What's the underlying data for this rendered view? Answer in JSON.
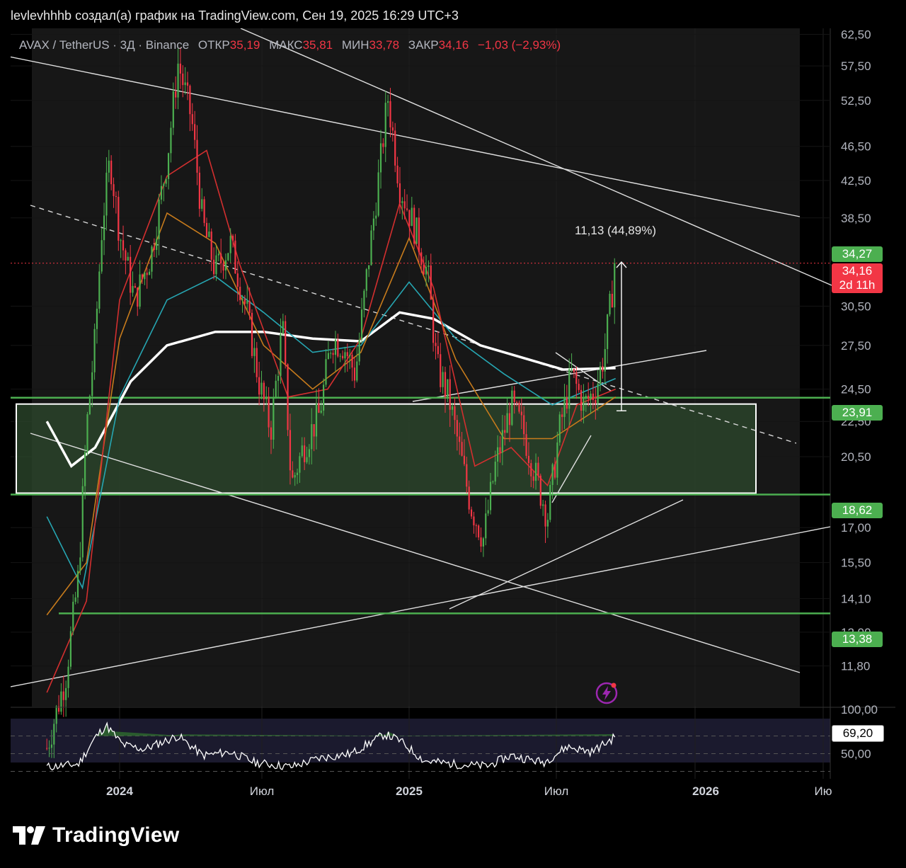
{
  "header": {
    "text": "levlevhhhb создал(а) график на TradingView.com, Сен 19, 2025 16:29 UTC+3"
  },
  "legend": {
    "symbol": "AVAX / TetherUS · 3Д · Binance",
    "open_label": "ОТКР",
    "open": "35,19",
    "high_label": "МАКС",
    "high": "35,81",
    "low_label": "МИН",
    "low": "33,78",
    "close_label": "ЗАКР",
    "close": "34,16",
    "change": "−1,03 (−2,93%)"
  },
  "measure_label": "11,13 (44,89%)",
  "price_tags": {
    "top": "34,27",
    "current": "34,16",
    "countdown": "2d 11h",
    "level_a": "23,91",
    "level_b": "18,62",
    "level_c": "13,38",
    "rsi_value": "69,20"
  },
  "colors": {
    "bull": "#4caf50",
    "bear": "#f23645",
    "level_green": "#4caf50",
    "zone_fill": "#2e4a2e",
    "ema_white": "#ffffff",
    "ema_red": "#d32f2f",
    "ema_orange": "#c77b1c",
    "ema_teal": "#26a6b2",
    "rsi_band": "#1b1a2e",
    "brand_purple": "#9c27b0"
  },
  "icons": {
    "brand": "tradingview-logo-icon",
    "alert": "lightning-bolt-icon"
  },
  "chart_data": {
    "type": "candlestick",
    "title": "AVAX / TetherUS · 3Д · Binance",
    "y_axis": {
      "scale": "log",
      "ticks": [
        "62,50",
        "57,50",
        "52,50",
        "46,50",
        "42,50",
        "38,50",
        "30,50",
        "27,50",
        "24,50",
        "22,50",
        "20,50",
        "17,00",
        "15,50",
        "14,10",
        "12,90",
        "11,80"
      ]
    },
    "x_axis": {
      "ticks": [
        "2024",
        "Июл",
        "2025",
        "Июл",
        "2026",
        "Ию"
      ]
    },
    "price_path": [
      [
        "2023-10-01",
        9.5
      ],
      [
        "2023-10-25",
        11.5
      ],
      [
        "2023-11-10",
        15.0
      ],
      [
        "2023-11-20",
        22.0
      ],
      [
        "2023-12-01",
        28.0
      ],
      [
        "2023-12-10",
        38.0
      ],
      [
        "2023-12-20",
        45.0
      ],
      [
        "2024-01-01",
        37.0
      ],
      [
        "2024-01-20",
        31.0
      ],
      [
        "2024-02-10",
        35.0
      ],
      [
        "2024-03-01",
        45.0
      ],
      [
        "2024-03-15",
        58.0
      ],
      [
        "2024-04-01",
        50.0
      ],
      [
        "2024-04-15",
        38.0
      ],
      [
        "2024-05-01",
        33.5
      ],
      [
        "2024-05-20",
        36.0
      ],
      [
        "2024-06-10",
        30.0
      ],
      [
        "2024-06-25",
        25.0
      ],
      [
        "2024-07-10",
        22.0
      ],
      [
        "2024-07-25",
        29.0
      ],
      [
        "2024-08-05",
        19.0
      ],
      [
        "2024-08-20",
        21.0
      ],
      [
        "2024-09-10",
        23.0
      ],
      [
        "2024-09-25",
        28.0
      ],
      [
        "2024-10-10",
        27.5
      ],
      [
        "2024-10-25",
        25.5
      ],
      [
        "2024-11-10",
        34.0
      ],
      [
        "2024-11-25",
        44.0
      ],
      [
        "2024-12-05",
        53.0
      ],
      [
        "2024-12-20",
        42.0
      ],
      [
        "2025-01-10",
        37.0
      ],
      [
        "2025-01-25",
        33.0
      ],
      [
        "2025-02-05",
        26.0
      ],
      [
        "2025-02-20",
        24.0
      ],
      [
        "2025-03-05",
        21.0
      ],
      [
        "2025-03-20",
        18.0
      ],
      [
        "2025-04-05",
        16.5
      ],
      [
        "2025-04-20",
        20.0
      ],
      [
        "2025-05-10",
        23.5
      ],
      [
        "2025-05-25",
        22.0
      ],
      [
        "2025-06-10",
        19.5
      ],
      [
        "2025-06-25",
        17.5
      ],
      [
        "2025-07-10",
        22.0
      ],
      [
        "2025-07-25",
        25.5
      ],
      [
        "2025-08-10",
        23.5
      ],
      [
        "2025-08-25",
        24.5
      ],
      [
        "2025-09-05",
        27.0
      ],
      [
        "2025-09-19",
        34.16
      ]
    ],
    "moving_averages": [
      {
        "color": "white",
        "points": [
          [
            "2023-10-01",
            22.5
          ],
          [
            "2023-11-01",
            20.0
          ],
          [
            "2023-12-01",
            21.0
          ],
          [
            "2024-01-15",
            25.0
          ],
          [
            "2024-03-01",
            27.5
          ],
          [
            "2024-05-01",
            28.5
          ],
          [
            "2024-07-01",
            28.5
          ],
          [
            "2024-09-01",
            28.0
          ],
          [
            "2024-11-01",
            27.8
          ],
          [
            "2024-12-20",
            30.0
          ],
          [
            "2025-02-01",
            29.5
          ],
          [
            "2025-04-01",
            27.5
          ],
          [
            "2025-06-01",
            26.5
          ],
          [
            "2025-07-15",
            25.8
          ],
          [
            "2025-09-19",
            25.9
          ]
        ]
      },
      {
        "color": "teal",
        "points": [
          [
            "2023-10-01",
            17.5
          ],
          [
            "2023-11-15",
            14.5
          ],
          [
            "2024-01-01",
            24.0
          ],
          [
            "2024-03-01",
            31.0
          ],
          [
            "2024-05-01",
            33.0
          ],
          [
            "2024-07-01",
            30.0
          ],
          [
            "2024-09-01",
            27.0
          ],
          [
            "2024-11-01",
            27.5
          ],
          [
            "2025-01-01",
            32.5
          ],
          [
            "2025-03-01",
            28.0
          ],
          [
            "2025-05-01",
            25.5
          ],
          [
            "2025-07-01",
            23.5
          ],
          [
            "2025-09-19",
            25.2
          ]
        ]
      },
      {
        "color": "orange",
        "points": [
          [
            "2023-10-01",
            13.5
          ],
          [
            "2023-11-20",
            15.5
          ],
          [
            "2024-01-01",
            28.0
          ],
          [
            "2024-03-01",
            39.0
          ],
          [
            "2024-05-01",
            36.0
          ],
          [
            "2024-07-01",
            27.5
          ],
          [
            "2024-09-01",
            24.5
          ],
          [
            "2024-11-01",
            27.0
          ],
          [
            "2025-01-01",
            36.5
          ],
          [
            "2025-03-01",
            26.5
          ],
          [
            "2025-05-01",
            21.5
          ],
          [
            "2025-07-01",
            21.5
          ],
          [
            "2025-09-19",
            24.0
          ]
        ]
      },
      {
        "color": "red",
        "points": [
          [
            "2023-10-01",
            11.0
          ],
          [
            "2023-11-20",
            14.0
          ],
          [
            "2024-01-01",
            31.0
          ],
          [
            "2024-03-01",
            43.0
          ],
          [
            "2024-04-20",
            46.0
          ],
          [
            "2024-06-01",
            34.0
          ],
          [
            "2024-08-01",
            24.0
          ],
          [
            "2024-09-20",
            24.5
          ],
          [
            "2024-11-01",
            28.0
          ],
          [
            "2024-12-20",
            40.0
          ],
          [
            "2025-02-01",
            32.0
          ],
          [
            "2025-03-25",
            20.0
          ],
          [
            "2025-05-10",
            21.0
          ],
          [
            "2025-06-25",
            19.0
          ],
          [
            "2025-08-01",
            23.5
          ],
          [
            "2025-09-19",
            24.5
          ]
        ]
      }
    ],
    "levels": [
      23.91,
      18.62,
      13.38
    ],
    "current_price": 34.16,
    "zone": {
      "top": 23.91,
      "bottom": 18.62
    },
    "measure": {
      "from": 23.14,
      "to": 34.27,
      "label": "11,13 (44,89%)"
    },
    "rsi": {
      "ticks": [
        "100,00",
        "50,00"
      ],
      "last": 69.2,
      "path": [
        [
          "2023-10-01",
          35
        ],
        [
          "2023-11-10",
          38
        ],
        [
          "2023-12-01",
          68
        ],
        [
          "2023-12-15",
          82
        ],
        [
          "2024-01-05",
          60
        ],
        [
          "2024-02-01",
          55
        ],
        [
          "2024-03-15",
          70
        ],
        [
          "2024-04-15",
          48
        ],
        [
          "2024-05-20",
          52
        ],
        [
          "2024-06-20",
          40
        ],
        [
          "2024-08-05",
          35
        ],
        [
          "2024-09-10",
          45
        ],
        [
          "2024-10-20",
          50
        ],
        [
          "2024-12-01",
          72
        ],
        [
          "2024-12-20",
          65
        ],
        [
          "2025-01-20",
          42
        ],
        [
          "2025-03-01",
          38
        ],
        [
          "2025-04-10",
          36
        ],
        [
          "2025-05-10",
          48
        ],
        [
          "2025-06-20",
          40
        ],
        [
          "2025-07-20",
          58
        ],
        [
          "2025-08-20",
          52
        ],
        [
          "2025-09-19",
          69.2
        ]
      ]
    }
  }
}
